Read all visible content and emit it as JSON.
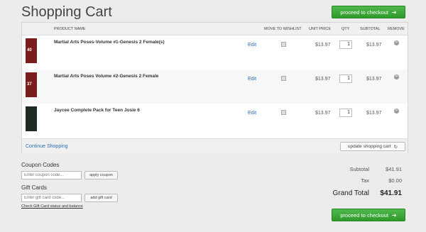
{
  "page_title": "Shopping Cart",
  "checkout_label": "proceed to checkout",
  "table_headers": {
    "product_name": "PRODUCT NAME",
    "move_to_wishlist": "MOVE TO WISHLIST",
    "unit_price": "UNIT PRICE",
    "qty": "QTY",
    "subtotal": "SUBTOTAL",
    "remove": "REMOVE"
  },
  "items": [
    {
      "name": "Martial Arts Poses-Volume #1-Genesis 2 Female(s)",
      "thumb_text": "40",
      "edit": "Edit",
      "unit_price": "$13.97",
      "qty": "1",
      "subtotal": "$13.97"
    },
    {
      "name": "Martial Arts Poses Volume #2-Genesis 2 Female",
      "thumb_text": "37",
      "edit": "Edit",
      "unit_price": "$13.97",
      "qty": "1",
      "subtotal": "$13.97"
    },
    {
      "name": "Jaycee Complete Pack for Teen Josie 6",
      "thumb_text": "",
      "edit": "Edit",
      "unit_price": "$13.97",
      "qty": "1",
      "subtotal": "$13.97"
    }
  ],
  "continue_shopping": "Continue Shopping",
  "update_cart": "update shopping cart",
  "coupon": {
    "heading": "Coupon Codes",
    "placeholder": "Enter coupon code...",
    "button": "apply coupon"
  },
  "gift": {
    "heading": "Gift Cards",
    "placeholder": "Enter gift card code...",
    "button": "add gift card",
    "link": "Check Gift Card status and balance"
  },
  "totals": {
    "subtotal_label": "Subtotal",
    "subtotal": "$41.91",
    "tax_label": "Tax",
    "tax": "$0.00",
    "grand_label": "Grand Total",
    "grand": "$41.91"
  },
  "colors": {
    "accent_green": "#3aa836",
    "link_blue": "#2a6fb5"
  }
}
